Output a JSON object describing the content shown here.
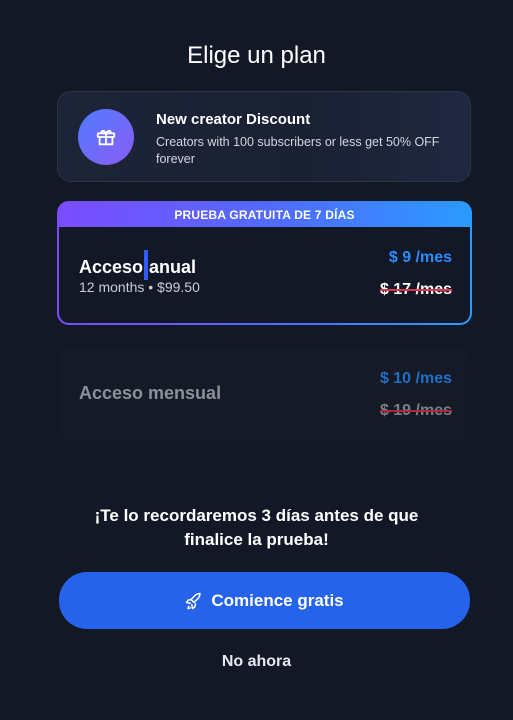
{
  "page": {
    "title": "Elige un plan"
  },
  "discount": {
    "icon": "gift-icon",
    "title": "New creator Discount",
    "description": "Creators with 100 subscribers or less get 50% OFF forever"
  },
  "plans": {
    "annual": {
      "badge": "PRUEBA GRATUITA DE 7 DÍAS",
      "name_part1": "Acceso",
      "name_part2": "anual",
      "subtitle": "12 months • $99.50",
      "price": "$ 9 /mes",
      "old_price": "$ 17 /mes",
      "selected": true
    },
    "monthly": {
      "name": "Acceso mensual",
      "price": "$ 10 /mes",
      "old_price": "$ 19 /mes",
      "selected": false
    }
  },
  "reminder": "¡Te lo recordaremos 3 días antes de que finalice la prueba!",
  "cta": {
    "icon": "rocket-icon",
    "label": "Comience gratis"
  },
  "secondary": {
    "label": "No ahora"
  },
  "colors": {
    "background": "#121826",
    "accent": "#2563eb",
    "price_blue": "#2b8bff",
    "strike_red": "#e0334c",
    "gradient_start": "#7b4cff",
    "gradient_end": "#2a9bff"
  }
}
